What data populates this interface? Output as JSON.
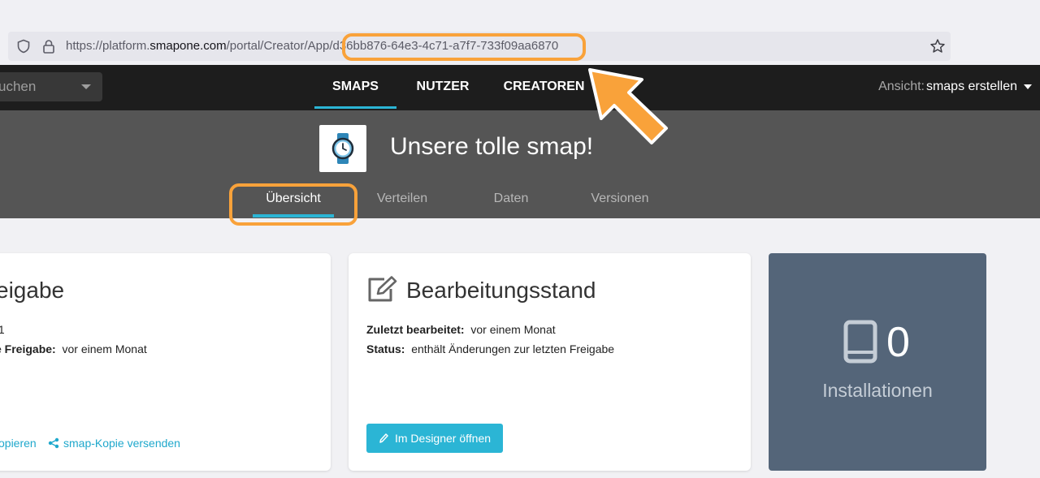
{
  "browser": {
    "url_prefix": "https://platform.",
    "url_host": "smapone.com",
    "url_path": "/portal/Creator/App/",
    "url_id": "d36bb876-64e3-4c71-a7f7-733f09aa6870",
    "icons": [
      "shield-icon",
      "lock-icon",
      "star-icon"
    ]
  },
  "nav": {
    "search_text": "uchen",
    "tabs": [
      {
        "label": "SMAPS",
        "active": true
      },
      {
        "label": "NUTZER",
        "active": false
      },
      {
        "label": "CREATOREN",
        "active": false
      }
    ],
    "view_label": "Ansicht:",
    "view_value": "smaps erstellen"
  },
  "header": {
    "app_title": "Unsere tolle smap!",
    "app_icon": "watch-icon",
    "tabs": [
      {
        "label": "Übersicht",
        "active": true
      },
      {
        "label": "Verteilen",
        "active": false
      },
      {
        "label": "Daten",
        "active": false
      },
      {
        "label": "Versionen",
        "active": false
      }
    ]
  },
  "release_card": {
    "title": "eigabe",
    "version_value": ".1",
    "release_label": "e Freigabe:",
    "release_value": "vor einem Monat",
    "link_copy": "opieren",
    "link_send": "smap-Kopie versenden"
  },
  "edit_card": {
    "title": "Bearbeitungsstand",
    "last_edited_label": "Zuletzt bearbeitet:",
    "last_edited_value": "vor einem Monat",
    "status_label": "Status:",
    "status_value": "enthält Änderungen zur letzten Freigabe",
    "button_label": "Im Designer öffnen"
  },
  "installs_card": {
    "count": "0",
    "label": "Installationen"
  },
  "colors": {
    "accent": "#2bb5d5",
    "annotation": "#f9a23a",
    "nav_bg": "#1d1d1d",
    "header_bg": "#555555",
    "stat_bg": "#546579"
  }
}
